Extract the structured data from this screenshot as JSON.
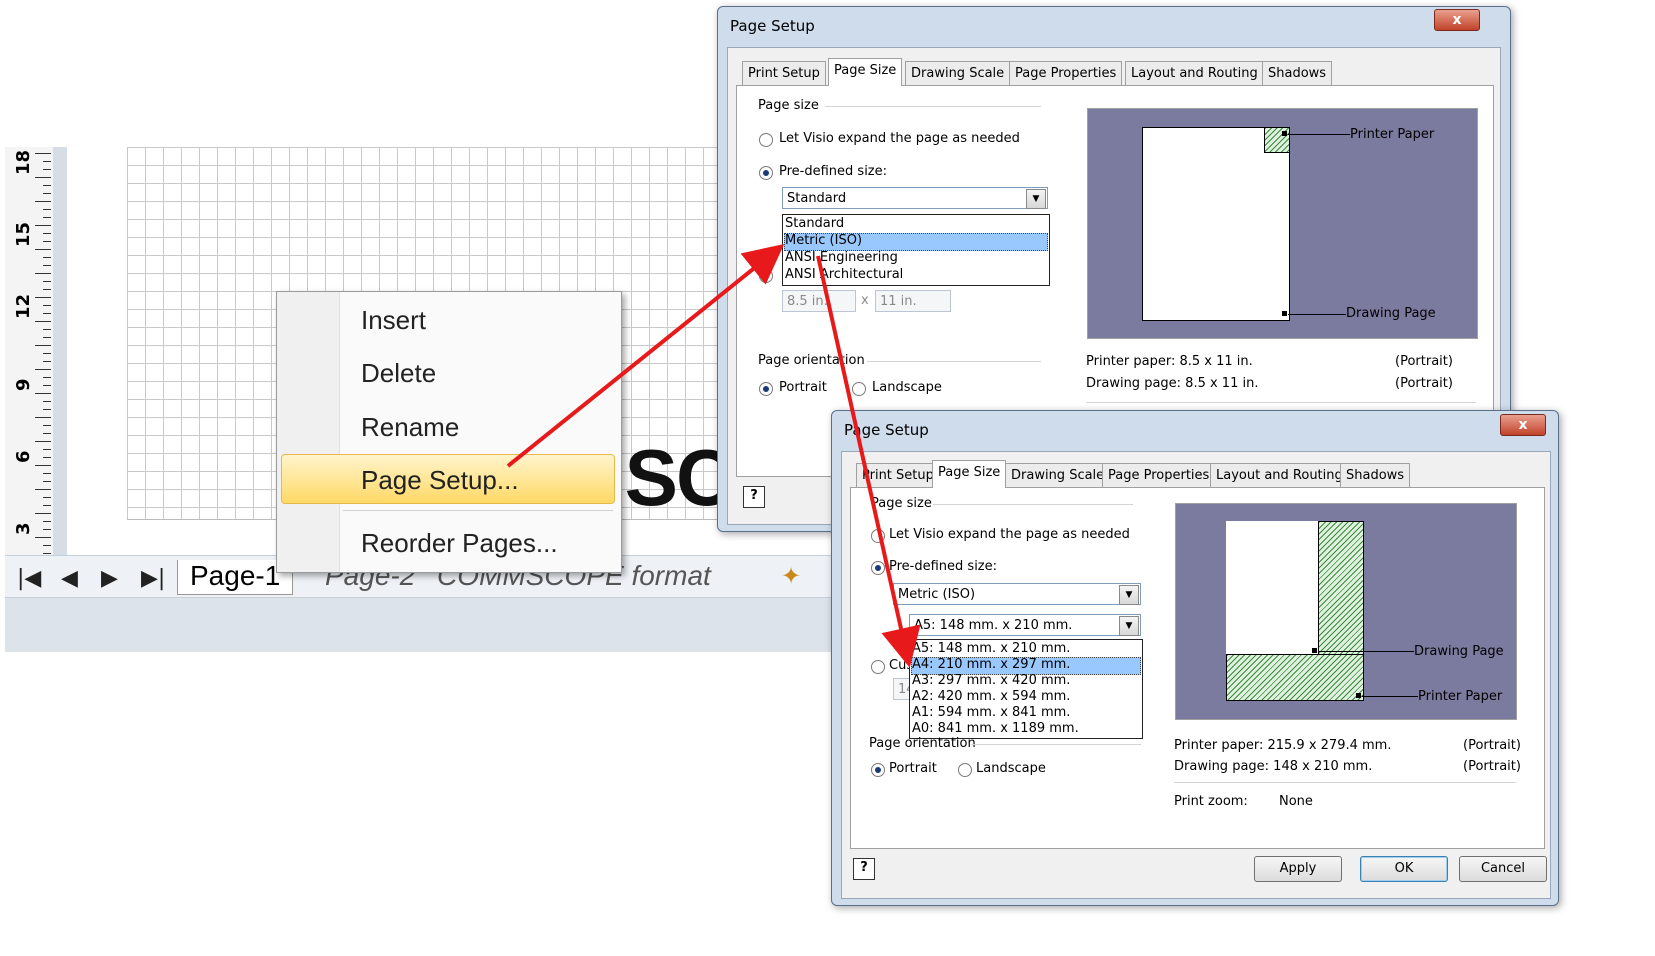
{
  "ruler": {
    "numbers": [
      "18",
      "15",
      "12",
      "9",
      "6",
      "3"
    ]
  },
  "canvas": {
    "big_text": "MSC"
  },
  "page_tabs": [
    {
      "label": "Page-1",
      "active": true
    },
    {
      "label": "Page-2",
      "active": false
    },
    {
      "label": "COMMSCOPE format",
      "active": false
    }
  ],
  "context_menu": {
    "items": [
      {
        "label": "Insert"
      },
      {
        "label": "Delete"
      },
      {
        "label": "Rename"
      },
      {
        "label": "Page Setup...",
        "highlighted": true
      },
      {
        "label": "Reorder Pages..."
      }
    ]
  },
  "dialog1": {
    "title": "Page Setup",
    "close_glyph": "x",
    "tabs": [
      "Print Setup",
      "Page Size",
      "Drawing Scale",
      "Page Properties",
      "Layout and Routing",
      "Shadows"
    ],
    "selected_tab": "Page Size",
    "group_page_size": "Page size",
    "radio_expand": "Let Visio expand the page as needed",
    "radio_predefined": "Pre-defined size:",
    "combo_value": "Standard",
    "dropdown_items": [
      "Standard",
      "Metric (ISO)",
      "ANSI Engineering",
      "ANSI Architectural"
    ],
    "dropdown_highlight": "Metric (ISO)",
    "custom_width": "8.5 in.",
    "custom_x": "x",
    "custom_height": "11 in.",
    "group_orientation": "Page orientation",
    "portrait": "Portrait",
    "landscape": "Landscape",
    "preview_printer_label": "Printer Paper",
    "preview_drawing_label": "Drawing Page",
    "printer_paper_line": "Printer paper:  8.5 x 11 in.",
    "printer_paper_orient": "(Portrait)",
    "drawing_page_line": "Drawing page:  8.5 x 11 in.",
    "drawing_page_orient": "(Portrait)",
    "help_glyph": "?"
  },
  "dialog2": {
    "title": "Page Setup",
    "close_glyph": "x",
    "tabs": [
      "Print Setup",
      "Page Size",
      "Drawing Scale",
      "Page Properties",
      "Layout and Routing",
      "Shadows"
    ],
    "selected_tab": "Page Size",
    "group_page_size": "Page size",
    "radio_expand": "Let Visio expand the page as needed",
    "radio_predefined": "Pre-defined size:",
    "combo1_value": "Metric (ISO)",
    "combo2_value": "A5:  148 mm. x 210 mm.",
    "dropdown_items": [
      "A5:  148 mm. x 210 mm.",
      "A4:  210 mm. x 297 mm.",
      "A3:  297 mm. x 420 mm.",
      "A2:  420 mm. x 594 mm.",
      "A1:  594 mm. x 841 mm.",
      "A0:  841 mm. x 1189 mm."
    ],
    "dropdown_highlight": "A4:  210 mm. x 297 mm.",
    "custom_partial": "Cus",
    "custom_field_partial": "14",
    "group_orientation": "Page orientation",
    "portrait": "Portrait",
    "landscape": "Landscape",
    "preview_drawing_label": "Drawing Page",
    "preview_printer_label": "Printer Paper",
    "printer_paper_line": "Printer paper:  215.9 x 279.4 mm.",
    "printer_paper_orient": "(Portrait)",
    "drawing_page_line": "Drawing page:  148 x 210 mm.",
    "drawing_page_orient": "(Portrait)",
    "print_zoom_label": "Print zoom:",
    "print_zoom_value": "None",
    "help_glyph": "?",
    "buttons": {
      "apply": "Apply",
      "ok": "OK",
      "cancel": "Cancel"
    }
  },
  "colors": {
    "arrow": "#e8191a",
    "menu_highlight": "#ffd966",
    "dropdown_highlight": "#99c8ff",
    "preview_bg": "#7b7a9f"
  }
}
